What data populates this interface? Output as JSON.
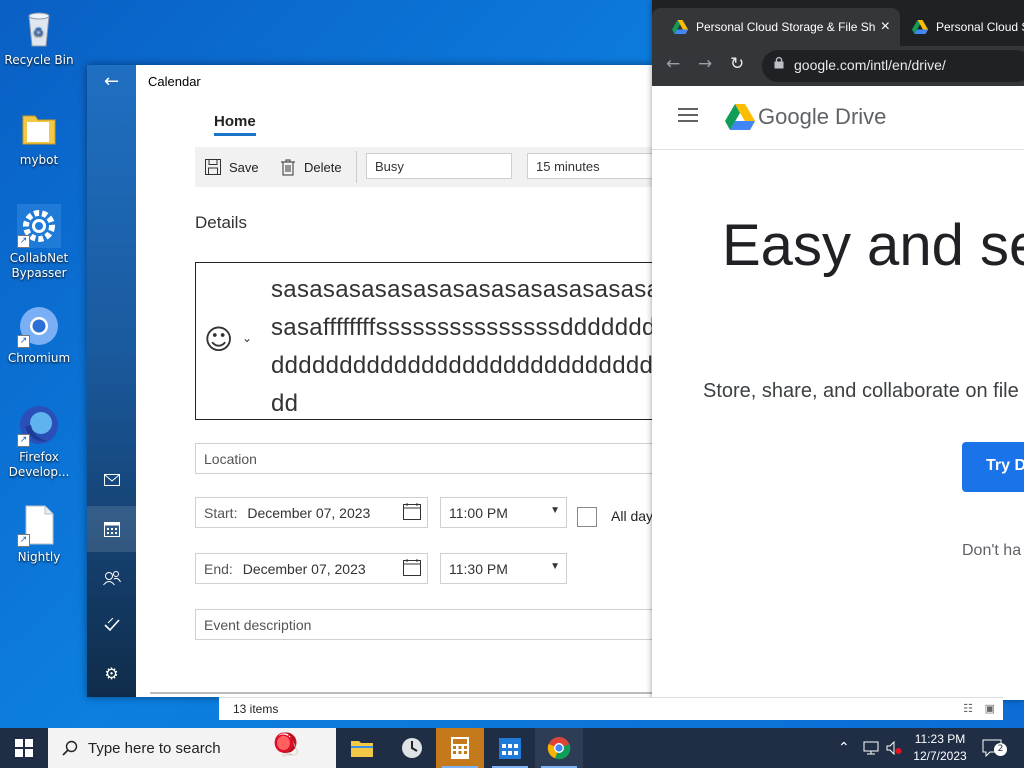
{
  "desktop": {
    "icons": [
      {
        "label": "Recycle Bin"
      },
      {
        "label": "mybot"
      },
      {
        "label": "CollabNet Bypasser"
      },
      {
        "label": "Chromium"
      },
      {
        "label": "Firefox Develop..."
      },
      {
        "label": "Nightly"
      }
    ]
  },
  "calendar": {
    "app_title": "Calendar",
    "tab": "Home",
    "toolbar": {
      "save_label": "Save",
      "delete_label": "Delete",
      "show_as_value": "Busy",
      "reminder_value": "15 minutes"
    },
    "details_heading": "Details",
    "event_title": "sasasasasasasasasasasasasasasasasaffffffffsssssssssssssssddddddddddddddddddddddddddddddddddddd",
    "location_placeholder": "Location",
    "start": {
      "label": "Start:",
      "date": "December 07, 2023",
      "time": "11:00 PM"
    },
    "end": {
      "label": "End:",
      "date": "December 07, 2023",
      "time": "11:30 PM"
    },
    "all_day_label": "All day",
    "description_placeholder": "Event description"
  },
  "chrome": {
    "tabs": [
      {
        "title": "Personal Cloud Storage & File Sh",
        "close": "×"
      },
      {
        "title": "Personal Cloud S"
      }
    ],
    "url": "google.com/intl/en/drive/",
    "page": {
      "brand": "Google Drive",
      "hero": "Easy and se",
      "subtitle": "Store, share, and collaborate on file",
      "cta": "Try D",
      "dont_have": "Don't ha"
    }
  },
  "explorer": {
    "item_count": "13 items"
  },
  "taskbar": {
    "search_placeholder": "Type here to search",
    "time": "11:23 PM",
    "date": "12/7/2023",
    "notification_count": "2"
  },
  "colors": {
    "accent": "#1a73c7",
    "desktop": "#0c7fe0",
    "taskbar": "#1f2e45",
    "drive_blue": "#1a73e8"
  }
}
